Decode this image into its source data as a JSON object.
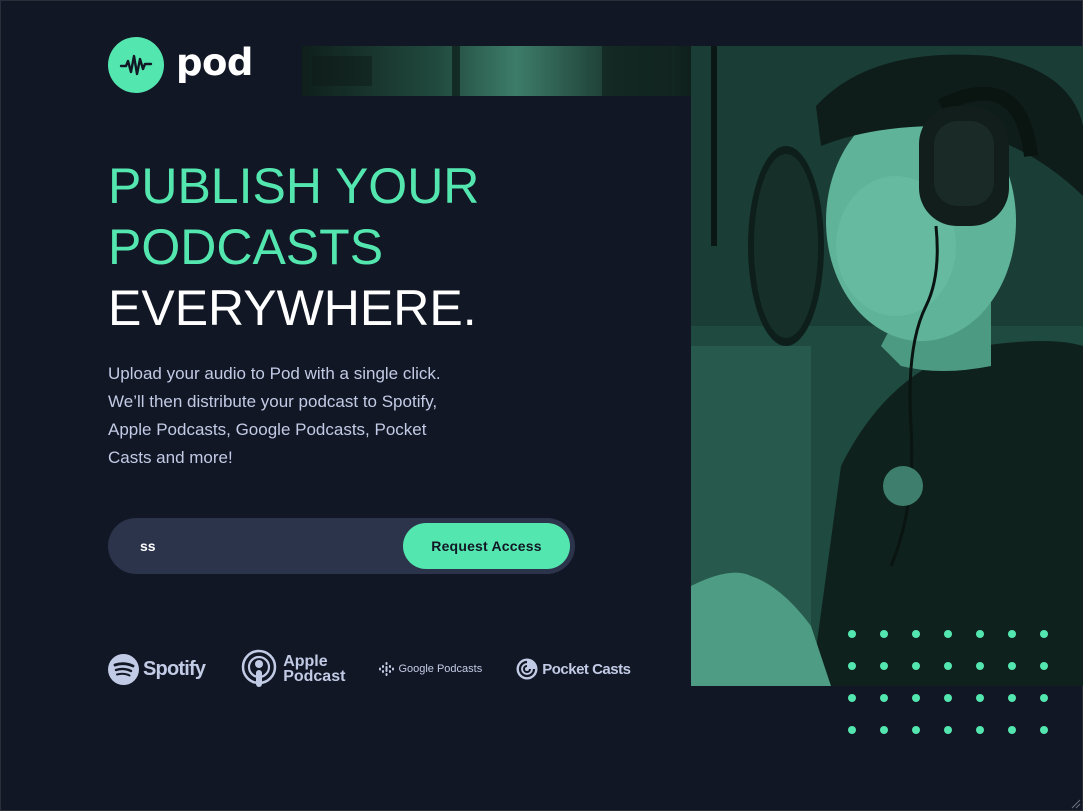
{
  "brand": {
    "name": "pod"
  },
  "hero": {
    "line1": "PUBLISH YOUR",
    "line2": "PODCASTS",
    "line3": "EVERYWHERE.",
    "description": "Upload your audio to Pod with a single click. We’ll then distribute your podcast to Spotify, Apple Podcasts, Google Podcasts, Pocket Casts and more!"
  },
  "form": {
    "email_value": "ss",
    "button_label": "Request Access"
  },
  "platforms": {
    "spotify": "Spotify",
    "apple_line1": "Apple",
    "apple_line2": "Podcast",
    "google": "Google Podcasts",
    "pocket": "Pocket Casts"
  },
  "colors": {
    "accent": "#54e6af",
    "background": "#121725",
    "input_bg": "#2c344b",
    "text_muted": "#c2cbe5"
  }
}
